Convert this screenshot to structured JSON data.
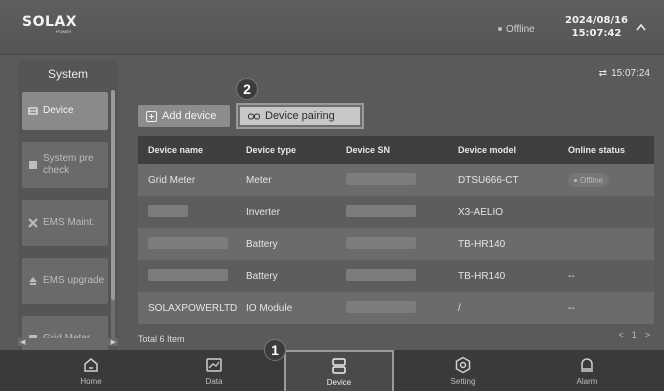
{
  "header": {
    "logo_text": "SOLAX",
    "logo_sub": "POWER",
    "status": "Offline",
    "date": "2024/08/16",
    "time": "15:07:42"
  },
  "sidebar": {
    "title": "System",
    "items": [
      {
        "label": "Device",
        "icon": "device-icon"
      },
      {
        "label": "System pre check",
        "icon": "check-icon"
      },
      {
        "label": "EMS Maint.",
        "icon": "wrench-icon"
      },
      {
        "label": "EMS upgrade",
        "icon": "upgrade-icon"
      },
      {
        "label": "Grid Meter",
        "icon": "meter-icon"
      }
    ]
  },
  "main": {
    "refresh_time": "15:07:24",
    "add_device_label": "Add device",
    "device_pairing_label": "Device pairing",
    "columns": [
      "Device name",
      "Device type",
      "Device SN",
      "Device model",
      "Online status"
    ],
    "rows": [
      {
        "name": "Grid Meter",
        "type": "Meter",
        "sn": "",
        "model": "DTSU666-CT",
        "status": "Offline"
      },
      {
        "name": "",
        "type": "Inverter",
        "sn": "",
        "model": "X3-AELIO",
        "status": ""
      },
      {
        "name": "",
        "type": "Battery",
        "sn": "",
        "model": "TB-HR140",
        "status": ""
      },
      {
        "name": "",
        "type": "Battery",
        "sn": "",
        "model": "TB-HR140",
        "status": "--"
      },
      {
        "name": "SOLAXPOWERLTD",
        "type": "IO Module",
        "sn": "",
        "model": "/",
        "status": "--"
      }
    ],
    "total": "Total 6 Item",
    "pager": [
      "<",
      "1",
      ">"
    ]
  },
  "annotations": {
    "badge_1": "1",
    "badge_2": "2"
  },
  "bottom_nav": [
    {
      "label": "Home",
      "icon": "home-icon"
    },
    {
      "label": "Data",
      "icon": "chart-icon"
    },
    {
      "label": "Device",
      "icon": "device-stack-icon"
    },
    {
      "label": "Setting",
      "icon": "gear-icon"
    },
    {
      "label": "Alarm",
      "icon": "alarm-icon"
    }
  ]
}
